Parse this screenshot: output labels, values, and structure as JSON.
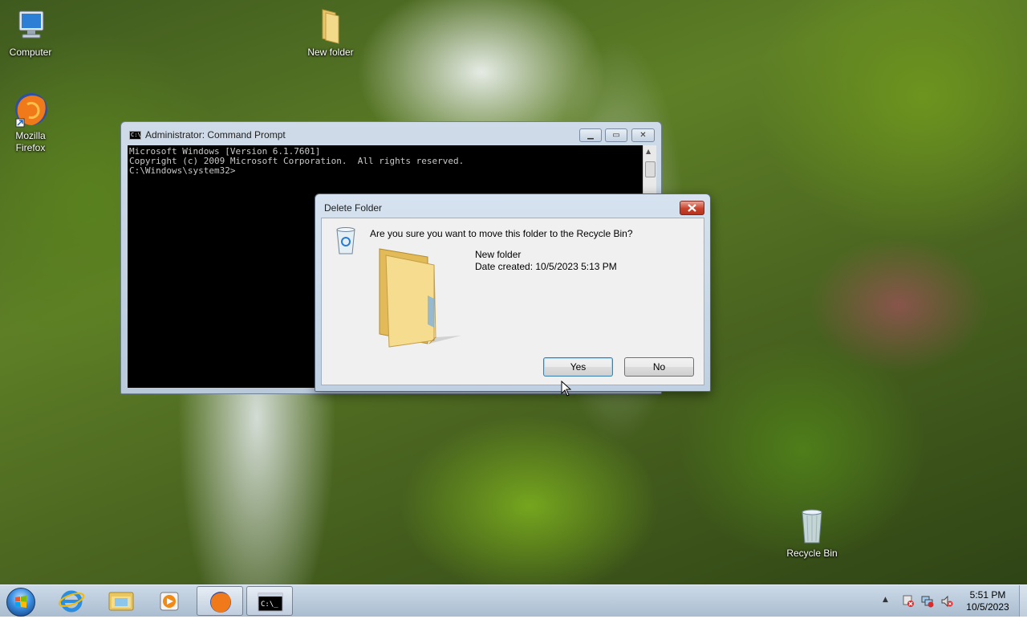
{
  "desktop": {
    "icons": [
      {
        "label": "Computer"
      },
      {
        "label": "New folder"
      },
      {
        "label": "Mozilla Firefox"
      },
      {
        "label": "Recycle Bin"
      }
    ]
  },
  "cmd": {
    "title": "Administrator: Command Prompt",
    "console_lines": [
      "Microsoft Windows [Version 6.1.7601]",
      "Copyright (c) 2009 Microsoft Corporation.  All rights reserved.",
      "",
      "C:\\Windows\\system32>"
    ]
  },
  "dialog": {
    "title": "Delete Folder",
    "question": "Are you sure you want to move this folder to the Recycle Bin?",
    "file_name": "New folder",
    "date_created": "Date created: 10/5/2023 5:13 PM",
    "yes_label": "Yes",
    "no_label": "No"
  },
  "taskbar": {
    "time": "5:51 PM",
    "date": "10/5/2023",
    "pinned": [
      "start-button",
      "internet-explorer",
      "windows-explorer",
      "windows-media-player",
      "firefox",
      "command-prompt"
    ]
  },
  "colors": {
    "console_bg": "#000000",
    "console_text": "#c8c8c8",
    "close_red": "#c9422c"
  }
}
